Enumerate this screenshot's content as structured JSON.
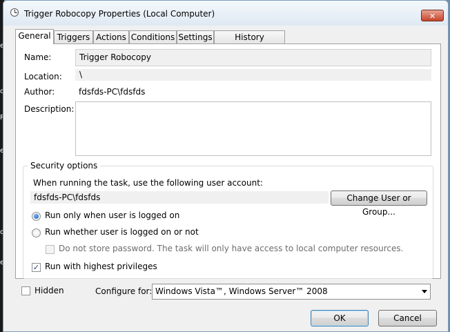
{
  "window": {
    "title": "Trigger Robocopy Properties (Local Computer)",
    "close_glyph": "✕"
  },
  "background_edge_chars": [
    "e",
    "o",
    "R",
    "e",
    "o",
    "e"
  ],
  "tabs": [
    {
      "label": "General",
      "active": true
    },
    {
      "label": "Triggers"
    },
    {
      "label": "Actions"
    },
    {
      "label": "Conditions"
    },
    {
      "label": "Settings"
    },
    {
      "label": "History (disabled)"
    }
  ],
  "general": {
    "name_label": "Name:",
    "name_value": "Trigger Robocopy",
    "location_label": "Location:",
    "location_value": "\\",
    "author_label": "Author:",
    "author_value": "fdsfds-PC\\fdsfds",
    "description_label": "Description:",
    "description_value": ""
  },
  "security": {
    "legend": "Security options",
    "account_prompt": "When running the task, use the following user account:",
    "account_value": "fdsfds-PC\\fdsfds",
    "change_button": "Change User or Group...",
    "radio_logged_on": "Run only when user is logged on",
    "radio_whether": "Run whether user is logged on or not",
    "no_store_password": "Do not store password.  The task will only have access to local computer resources.",
    "highest_privileges": "Run with highest privileges",
    "checkmark": "✓",
    "run_only_logged_on_selected": true,
    "highest_privileges_checked": true,
    "no_store_password_checked": false
  },
  "footer": {
    "hidden_label": "Hidden",
    "hidden_checked": false,
    "configure_label": "Configure for:",
    "configure_value": "Windows Vista™, Windows Server™ 2008",
    "ok": "OK",
    "cancel": "Cancel"
  }
}
